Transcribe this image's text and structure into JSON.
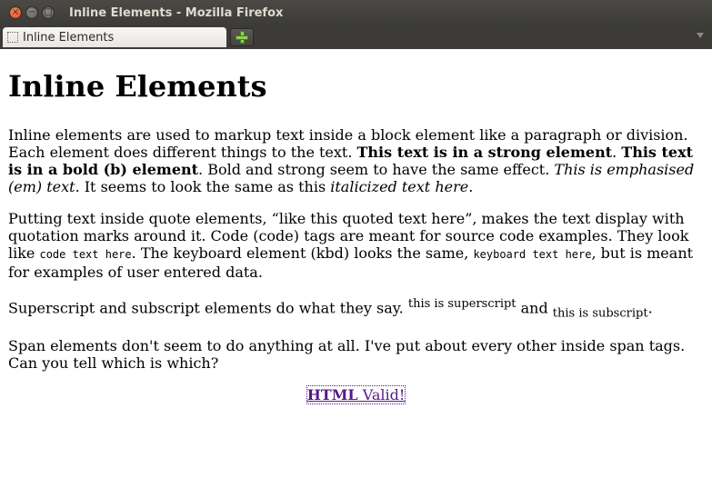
{
  "window": {
    "title": "Inline Elements - Mozilla Firefox"
  },
  "tabs": [
    {
      "label": "Inline Elements"
    }
  ],
  "page": {
    "heading": "Inline Elements",
    "p1": {
      "t1": "Inline elements are used to markup text inside a block element like a paragraph or division. Each element does different things to the text. ",
      "strong": "This text is in a strong element",
      "t2": ". ",
      "bold": "This text is in a bold (b) element",
      "t3": ". Bold and strong seem to have the same effect. ",
      "em": "This is emphasised (em) text",
      "t4": ". It seems to look the same as this ",
      "italic": "italicized text here",
      "t5": "."
    },
    "p2": {
      "t1": "Putting text inside quote elements, ",
      "quote": "“like this quoted text here”",
      "t2": ", makes the text display with quotation marks around it. Code (code) tags are meant for source code examples. They look like ",
      "code": "code text here",
      "t3": ". The keyboard element (kbd) looks the same, ",
      "kbd": "keyboard text here",
      "t4": ", but is meant for examples of user entered data."
    },
    "p3": {
      "t1": "Superscript and subscript elements do what they say. ",
      "sup": "this is superscript",
      "t2": " and ",
      "sub": "this is subscript",
      "t3": "."
    },
    "p4": "Span elements don't seem to do anything at all. I've put about every other inside span tags. Can you tell which is which?",
    "valid_link": {
      "bold": "HTML",
      "rest": " Valid!"
    }
  },
  "colors": {
    "link_visited": "#551a8b",
    "titlebar": "#3c3b37",
    "close_button": "#df4b16"
  }
}
